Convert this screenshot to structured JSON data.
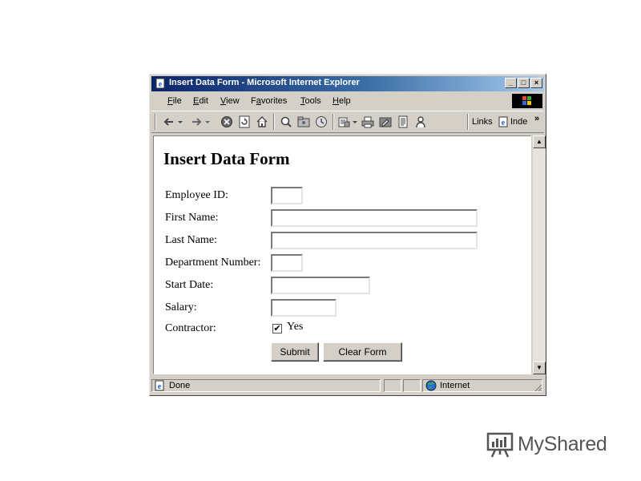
{
  "window": {
    "title": "Insert Data Form - Microsoft Internet Explorer",
    "controls": {
      "minimize": "_",
      "maximize": "□",
      "close": "×"
    }
  },
  "menu": {
    "items": [
      {
        "label": "File",
        "accel": "F",
        "rest": "ile"
      },
      {
        "label": "Edit",
        "accel": "E",
        "rest": "dit"
      },
      {
        "label": "View",
        "accel": "V",
        "rest": "iew"
      },
      {
        "label": "Favorites",
        "accel": "a",
        "pre": "F",
        "rest": "vorites"
      },
      {
        "label": "Tools",
        "accel": "T",
        "rest": "ools"
      },
      {
        "label": "Help",
        "accel": "H",
        "rest": "elp"
      }
    ]
  },
  "toolbar": {
    "links_label": "Links",
    "inde_label": "Inde",
    "overflow": "»"
  },
  "page": {
    "heading": "Insert Data Form",
    "fields": [
      {
        "label": "Employee ID:",
        "value": ""
      },
      {
        "label": "First Name:",
        "value": ""
      },
      {
        "label": "Last Name:",
        "value": ""
      },
      {
        "label": "Department Number:",
        "value": ""
      },
      {
        "label": "Start Date:",
        "value": ""
      },
      {
        "label": "Salary:",
        "value": ""
      }
    ],
    "contractor": {
      "label": "Contractor:",
      "option_label": "Yes",
      "checked": true,
      "check_mark": "✔"
    },
    "submit_label": "Submit",
    "clear_label": "Clear Form"
  },
  "scrollbar": {
    "up": "▲",
    "down": "▼"
  },
  "status": {
    "text": "Done",
    "zone": "Internet"
  },
  "watermark": {
    "text": "MyShared"
  },
  "colors": {
    "title_start": "#0a246a",
    "title_end": "#a6caf0",
    "chrome": "#d4d0c8"
  }
}
